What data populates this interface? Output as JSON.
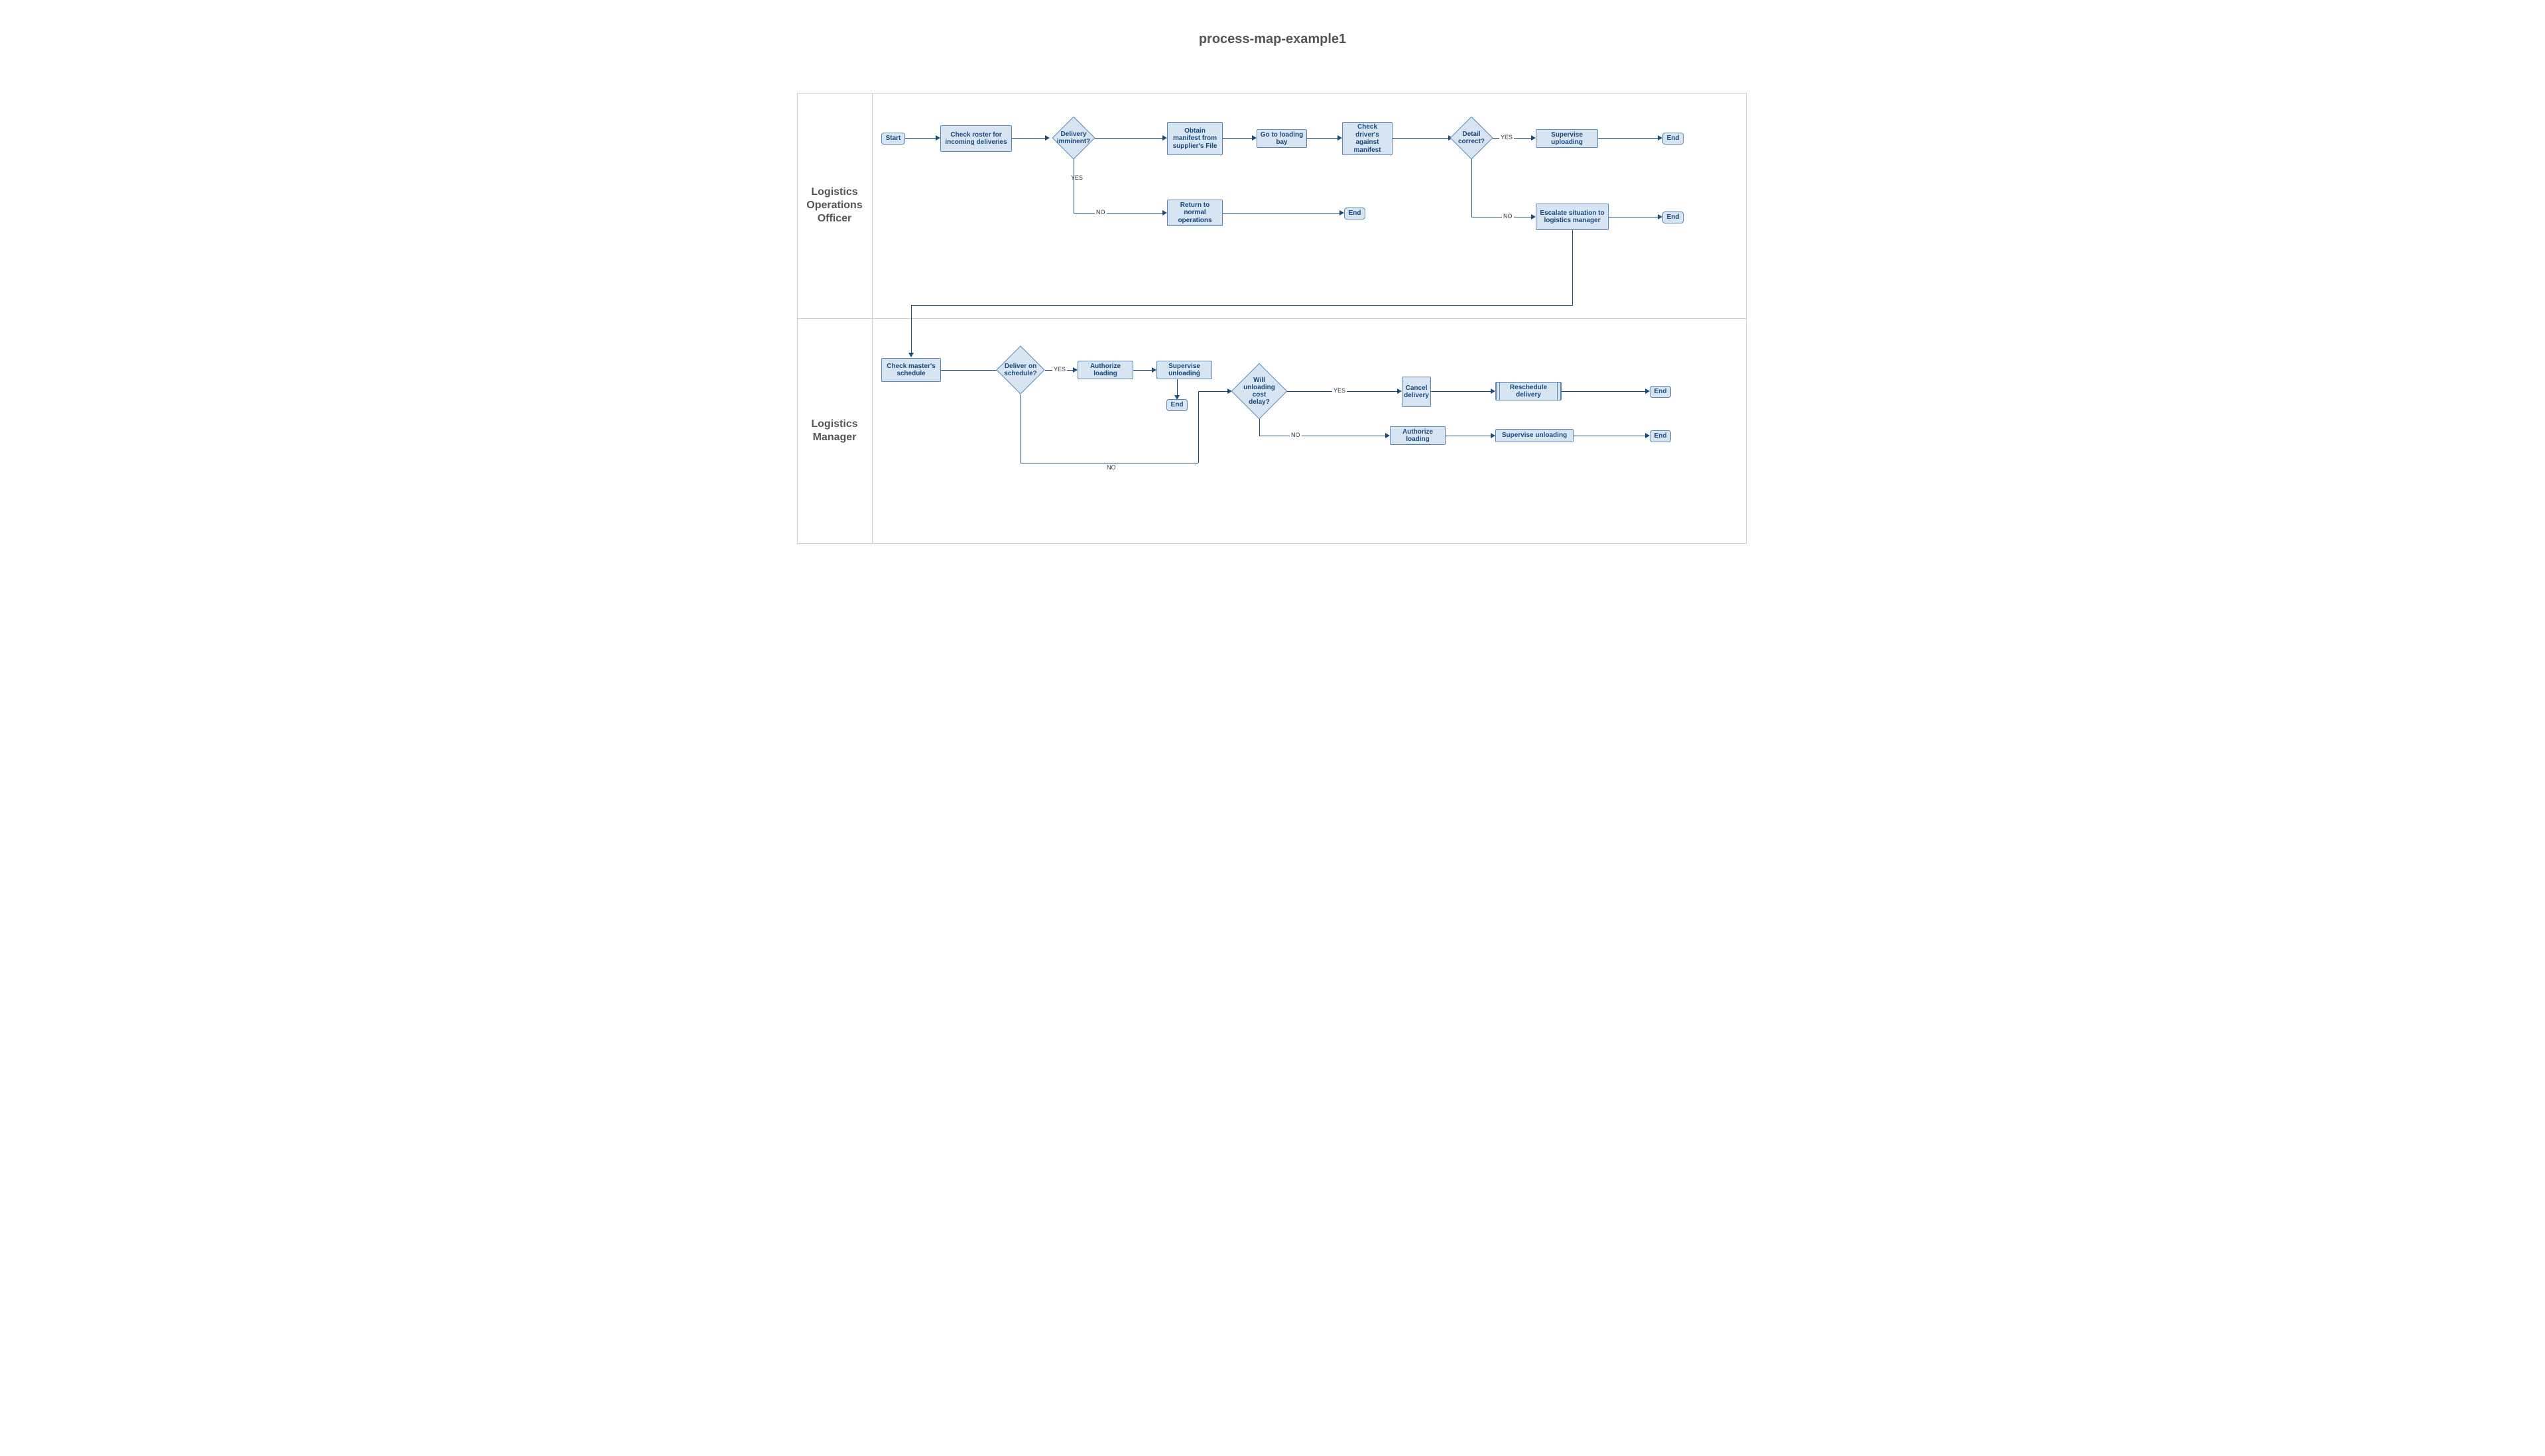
{
  "title": "process-map-example1",
  "lanes": {
    "lane1": {
      "label": "Logistics Operations Officer"
    },
    "lane2": {
      "label": "Logistics Manager"
    }
  },
  "labels": {
    "yes": "YES",
    "no": "NO"
  },
  "nodes": {
    "start": "Start",
    "checkRoster": "Check roster for incoming deliveries",
    "deliveryImminent": "Delivery imminent?",
    "obtainManifest": "Obtain manifest from supplier's File",
    "goLoadingBay": "Go to loading bay",
    "checkDriver": "Check driver's against manifest",
    "detailCorrect": "Detail correct?",
    "superviseUploading": "Supervise uploading",
    "end1": "End",
    "returnNormal": "Return to normal operations",
    "end2": "End",
    "escalate": "Escalate situation to logistics manager",
    "end3": "End",
    "checkMaster": "Check master's schedule",
    "deliverSchedule": "Deliver on schedule?",
    "authorizeLoading": "Authorize loading",
    "superviseUnloading": "Supervise unloading",
    "end4": "End",
    "willUnloading": "Will unloading cost delay?",
    "cancelDelivery": "Cancel delivery",
    "rescheduleDelivery": "Reschedule delivery",
    "end5": "End",
    "authorizeLoading2": "Authorize loading",
    "superviseUnloading2": "Supervise unloading",
    "end6": "End"
  }
}
